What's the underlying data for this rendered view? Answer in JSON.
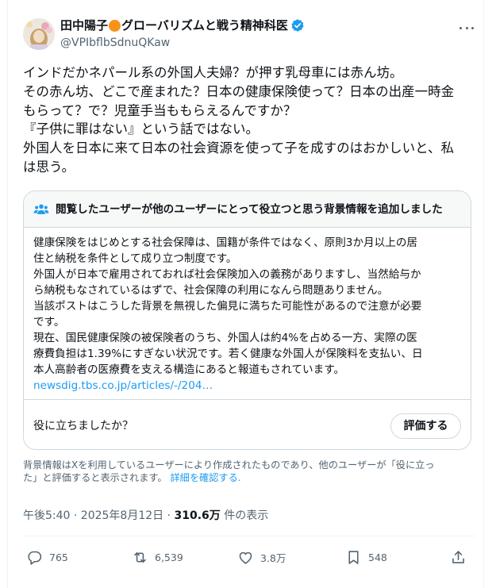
{
  "tweet": {
    "display_name": {
      "before_emoji": "田中陽子",
      "after_emoji": "グローバリズムと戦う精神科医"
    },
    "handle": "@VPIbflbSdnuQKaw",
    "body_lines": [
      "インドだかネパール系の外国人夫婦？が押す乳母車には赤ん坊。",
      "その赤ん坊、どこで産まれた？日本の健康保険使って？日本の出産一時金",
      "もらって？で？児童手当ももらえるんですか？",
      "『子供に罪はない』という話ではない。",
      "外国人を日本に来て日本の社会資源を使って子を成すのはおかしいと、私",
      "は思う。"
    ]
  },
  "community_note": {
    "title": "閲覧したユーザーが他のユーザーにとって役立つと思う背景情報を追加しました",
    "body_lines": [
      "健康保険をはじめとする社会保障は、国籍が条件ではなく、原則3か月以上の居",
      "住と納税を条件として成り立つ制度です。",
      "外国人が日本で雇用されておれば社会保険加入の義務がありますし、当然給与か",
      "ら納税もなされているはずで、社会保障の利用になんら問題ありません。",
      "当該ポストはこうした背景を無視した偏見に満ちた可能性があるので注意が必要",
      "です。",
      "現在、国民健康保険の被保険者のうち、外国人は約4%を占める一方、実際の医",
      "療費負担は1.39%にすぎない状況です。若く健康な外国人が保険料を支払い、日",
      "本人高齢者の医療費を支える構造にあると報道もされています。"
    ],
    "link": "newsdig.tbs.co.jp/articles/-/204…",
    "helpful_question": "役に立ちましたか？",
    "rate_button": "評価する",
    "disclaimer_line1": "背景情報はXを利用しているユーザーにより作成されたものであり、他のユーザーが「役に立っ",
    "disclaimer_line2": "た」と評価すると表示されます。",
    "details_link": "詳細を確認する."
  },
  "meta": {
    "time_date": "午後5:40 · 2025年8月12日 · ",
    "views_count": "310.6万",
    "views_label": " 件の表示"
  },
  "actions": {
    "replies": "765",
    "reposts": "6,539",
    "likes": "3.8万",
    "bookmarks": "548"
  },
  "colors": {
    "text": "#0f1419",
    "secondary": "#536471",
    "link": "#1d9bf0",
    "verified": "#1d9bf0",
    "emoji_circle": "#f7931a",
    "border": "#cfd9de"
  },
  "icons": [
    "avatar",
    "verified-badge-icon",
    "more-options-icon",
    "people-icon",
    "reply-icon",
    "repost-icon",
    "like-icon",
    "bookmark-icon",
    "share-icon"
  ]
}
